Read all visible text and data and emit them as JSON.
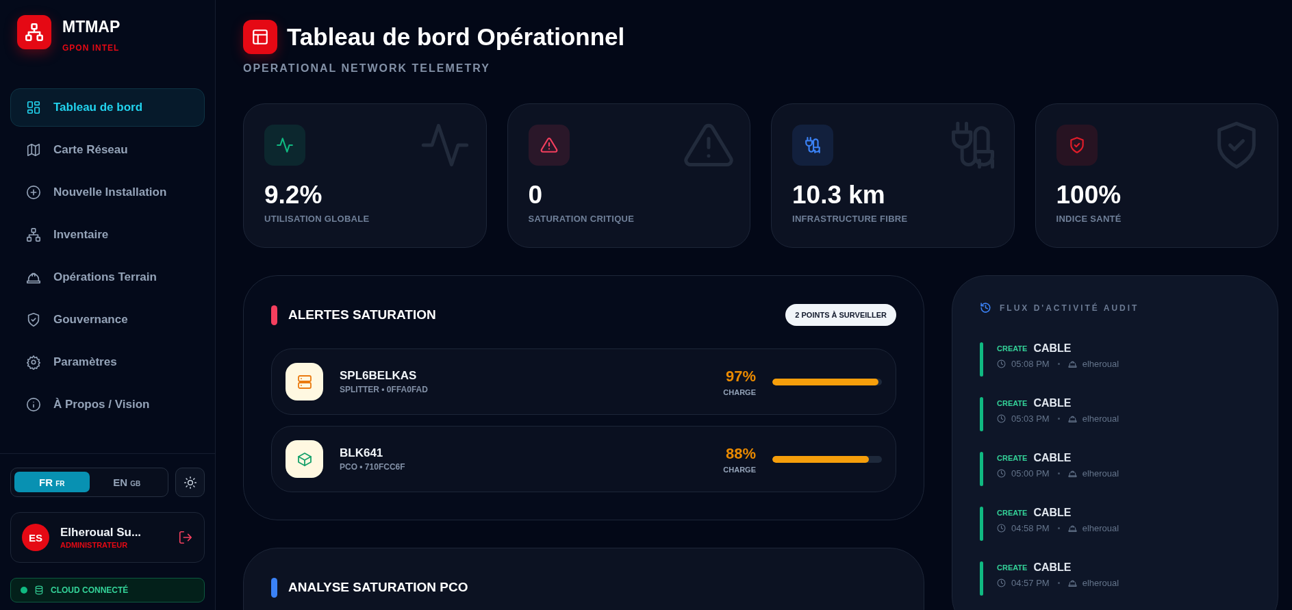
{
  "sidebar": {
    "brand": {
      "name": "MTMAP",
      "tagline": "GPON INTEL"
    },
    "nav": [
      {
        "kind": "grid",
        "label": "Tableau de bord",
        "selected": true
      },
      {
        "kind": "map",
        "label": "Carte Réseau",
        "selected": false
      },
      {
        "kind": "plus",
        "label": "Nouvelle Installation",
        "selected": false
      },
      {
        "kind": "network",
        "label": "Inventaire",
        "selected": false
      },
      {
        "kind": "hardhat",
        "label": "Opérations Terrain",
        "selected": false
      },
      {
        "kind": "shield",
        "label": "Gouvernance",
        "selected": false
      },
      {
        "kind": "gear",
        "label": "Paramètres",
        "selected": false
      },
      {
        "kind": "info",
        "label": "À Propos / Vision",
        "selected": false
      }
    ],
    "languages": [
      {
        "label": "FR",
        "flag": "FR",
        "selected": true
      },
      {
        "label": "EN",
        "flag": "GB",
        "selected": false
      }
    ],
    "user": {
      "initials": "ES",
      "name": "Elheroual Su...",
      "role": "ADMINISTRATEUR"
    },
    "connection": {
      "label": "CLOUD CONNECTÉ"
    }
  },
  "header": {
    "title": "Tableau de bord Opérationnel",
    "subtitle": "OPERATIONAL NETWORK TELEMETRY"
  },
  "stats": [
    {
      "kind": "activity",
      "color": "#10b981",
      "value": "9.2%",
      "label": "UTILISATION GLOBALE"
    },
    {
      "kind": "warning",
      "color": "#f43f5e",
      "value": "0",
      "label": "SATURATION CRITIQUE"
    },
    {
      "kind": "plug",
      "color": "#3b82f6",
      "value": "10.3 km",
      "label": "INFRASTRUCTURE FIBRE"
    },
    {
      "kind": "shield",
      "color": "#e11d2a",
      "value": "100%",
      "label": "INDICE SANTÉ"
    }
  ],
  "alerts": {
    "title": "ALERTES SATURATION",
    "badge": "2 POINTS À SURVEILLER",
    "items": [
      {
        "kind": "splitter",
        "name": "SPL6BELKAS",
        "detail": "SPLITTER • 0FFA0FAD",
        "percent": "97%",
        "caption": "CHARGE",
        "level": 0.97
      },
      {
        "kind": "pco",
        "name": "BLK641",
        "detail": "PCO • 710FCC6F",
        "percent": "88%",
        "caption": "CHARGE",
        "level": 0.88
      }
    ]
  },
  "analysis": {
    "title": "ANALYSE SATURATION PCO"
  },
  "activity": {
    "title": "FLUX D'ACTIVITÉ AUDIT",
    "items": [
      {
        "action": "CREATE",
        "object": "CABLE",
        "time": "05:08 PM",
        "user": "elheroual"
      },
      {
        "action": "CREATE",
        "object": "CABLE",
        "time": "05:03 PM",
        "user": "elheroual"
      },
      {
        "action": "CREATE",
        "object": "CABLE",
        "time": "05:00 PM",
        "user": "elheroual"
      },
      {
        "action": "CREATE",
        "object": "CABLE",
        "time": "04:58 PM",
        "user": "elheroual"
      },
      {
        "action": "CREATE",
        "object": "CABLE",
        "time": "04:57 PM",
        "user": "elheroual"
      }
    ]
  }
}
